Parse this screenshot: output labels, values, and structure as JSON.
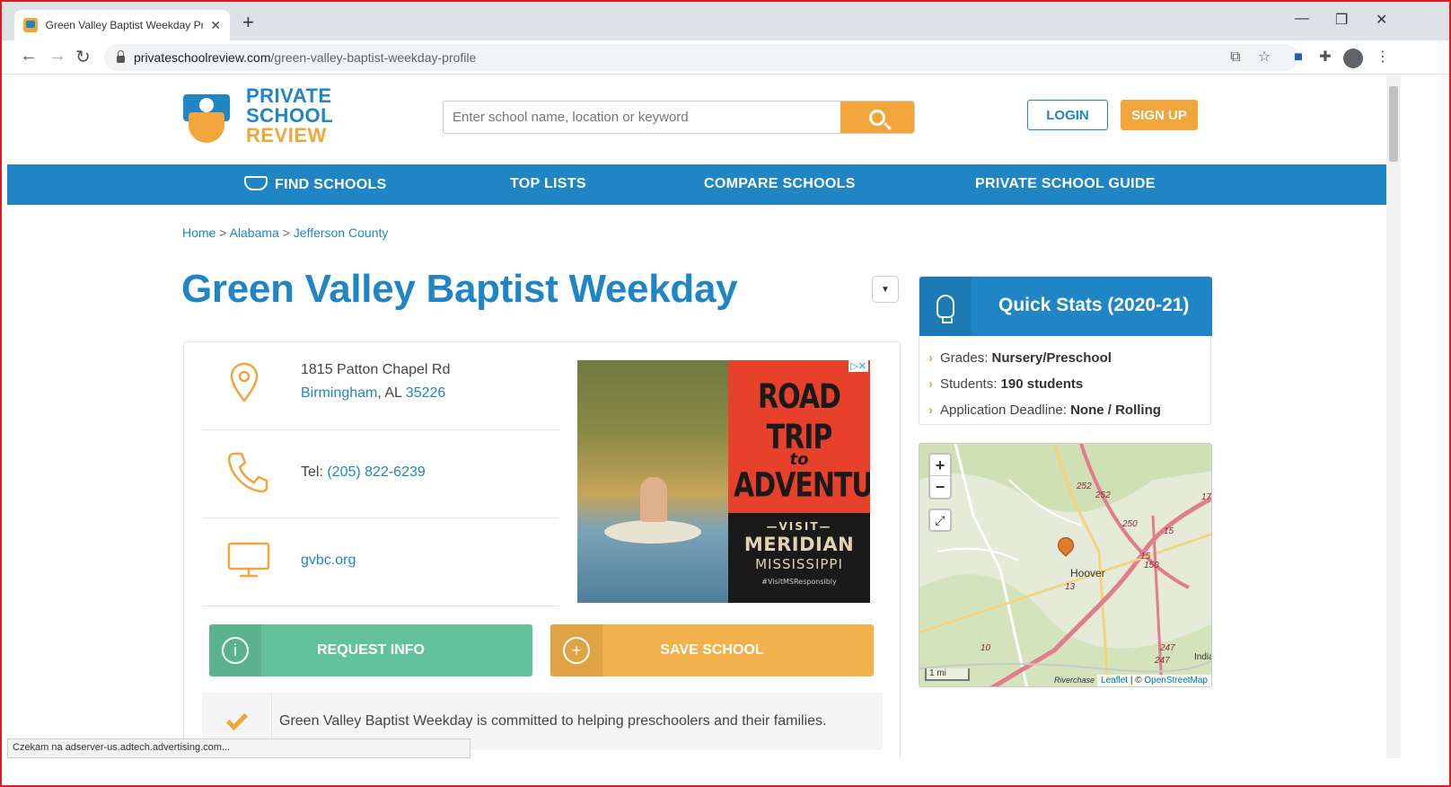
{
  "browser": {
    "tab_title": "Green Valley Baptist Weekday Pr",
    "url_domain": "privateschoolreview.com",
    "url_path": "/green-valley-baptist-weekday-profile"
  },
  "site": {
    "logo_line1": "PRIVATE",
    "logo_line2": "SCHOOL",
    "logo_line3": "REVIEW",
    "search_placeholder": "Enter school name, location or keyword",
    "login_label": "LOGIN",
    "signup_label": "SIGN UP",
    "nav": [
      "FIND SCHOOLS",
      "TOP LISTS",
      "COMPARE SCHOOLS",
      "PRIVATE SCHOOL GUIDE"
    ]
  },
  "breadcrumb": {
    "home": "Home",
    "state": "Alabama",
    "county": "Jefferson County",
    "sep": ">"
  },
  "school": {
    "name": "Green Valley Baptist Weekday",
    "address_line1": "1815 Patton Chapel Rd",
    "city": "Birmingham",
    "state": ", AL ",
    "zip": "35226",
    "tel_label": "Tel: ",
    "tel": "(205) 822-6239",
    "website": "gvbc.org",
    "mission": "Green Valley Baptist Weekday is committed to helping preschoolers and their families."
  },
  "actions": {
    "request_info": "REQUEST INFO",
    "save_school": "SAVE SCHOOL"
  },
  "ad": {
    "line1": "ROAD TRIP",
    "line2": "to",
    "line3": "ADVENTURE",
    "visit": "—VISIT—",
    "city": "MERIDIAN",
    "state": "MISSISSIPPI",
    "hashtag": "#VisitMSResponsibly"
  },
  "quick_stats": {
    "title": "Quick Stats (2020-21)",
    "items": [
      {
        "label": "Grades: ",
        "value": "Nursery/Preschool"
      },
      {
        "label": "Students: ",
        "value": "190 students"
      },
      {
        "label": "Application Deadline: ",
        "value": "None / Rolling"
      }
    ]
  },
  "map": {
    "zoom_in": "+",
    "zoom_out": "−",
    "city_label": "Hoover",
    "scale": "1 mi",
    "attrib_leaflet": "Leaflet",
    "attrib_sep": " | © ",
    "attrib_osm": "OpenStreetMap",
    "place_riverchase": "Riverchase",
    "place_india": "India",
    "roads": [
      "252",
      "252",
      "250",
      "15",
      "150",
      "17",
      "13",
      "10",
      "247",
      "247",
      "15"
    ]
  },
  "status_bar": "Czekam na adserver-us.adtech.advertising.com..."
}
